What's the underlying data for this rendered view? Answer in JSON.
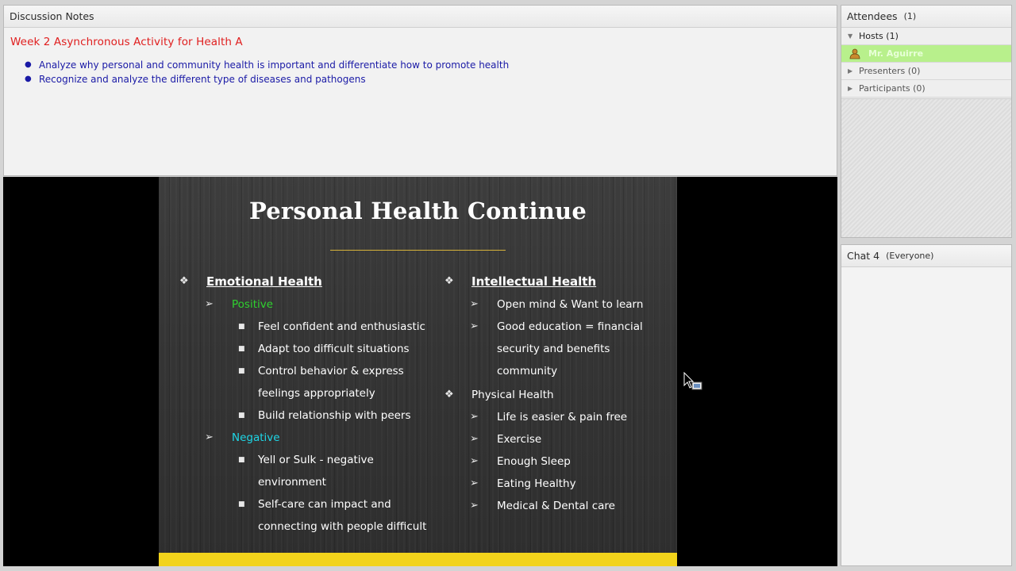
{
  "notes": {
    "header": "Discussion Notes",
    "title": "Week 2 Asynchronous Activity for Health A",
    "bullets": [
      "Analyze why personal and community health is important and differentiate how to promote health",
      "Recognize and analyze the different type of diseases and pathogens"
    ]
  },
  "slide": {
    "title": "Personal Health Continue",
    "left": {
      "heading": "Emotional Health",
      "positive_label": "Positive",
      "positive_items": [
        "Feel confident and enthusiastic",
        "Adapt too difficult situations",
        "Control behavior & express",
        "feelings appropriately",
        "Build relationship with peers"
      ],
      "negative_label": "Negative",
      "negative_items": [
        "Yell or Sulk - negative",
        "environment",
        "Self-care can impact and",
        "connecting with people difficult"
      ]
    },
    "right": {
      "heading": "Intellectual Health",
      "intellectual_items": [
        "Open mind & Want to learn",
        "Good education = financial",
        "security and benefits",
        "community"
      ],
      "physical_heading": "Physical Health",
      "physical_items": [
        "Life is easier & pain free",
        "Exercise",
        "Enough Sleep",
        "Eating Healthy",
        "Medical & Dental care"
      ]
    },
    "colors": {
      "accent_bar": "#f2d31b",
      "positive": "#2ed12e",
      "negative": "#1ed6e6"
    }
  },
  "attendees": {
    "header": "Attendees",
    "count": "(1)",
    "hosts": "Hosts (1)",
    "host_name": "Mr. Aguirre",
    "presenters": "Presenters (0)",
    "participants": "Participants (0)"
  },
  "chat": {
    "header": "Chat 4",
    "scope": "(Everyone)"
  },
  "icons": [
    "triangle-down-icon",
    "triangle-right-icon",
    "host-user-icon",
    "mouse-cursor-icon",
    "diamond-bullet-icon",
    "arrow-bullet-icon",
    "square-bullet-icon"
  ]
}
